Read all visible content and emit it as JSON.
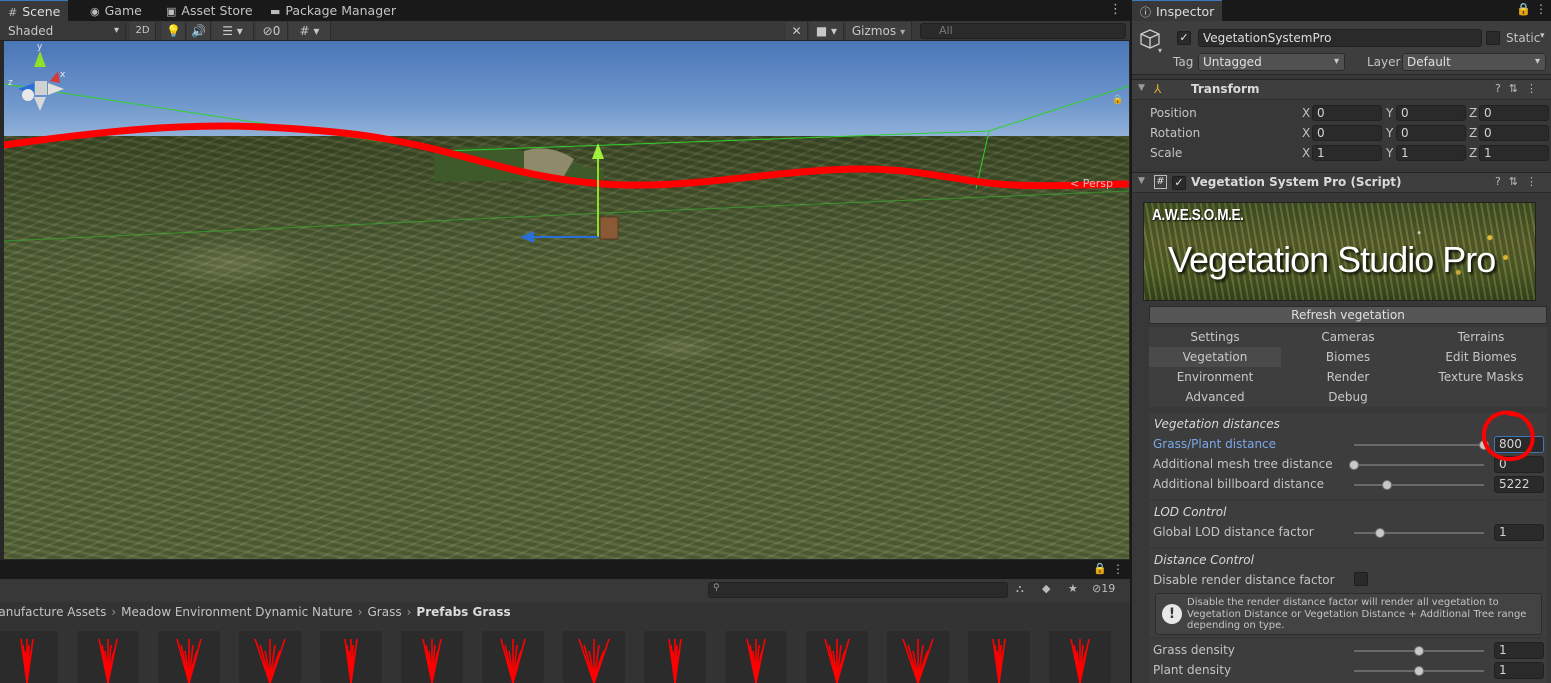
{
  "scene_tabs": {
    "scene": "Scene",
    "game": "Game",
    "asset_store": "Asset Store",
    "package_manager": "Package Manager"
  },
  "scene_toolbar": {
    "shading_mode": "Shaded",
    "mode_2d": "2D",
    "hidden_count": "0",
    "gizmos": "Gizmos",
    "search_placeholder": "All"
  },
  "viewport": {
    "persp_label": "< Persp",
    "gizmo_axes": {
      "x": "x",
      "y": "y",
      "z": "z"
    }
  },
  "project": {
    "hidden_count": "19",
    "breadcrumb": [
      "Manufacture Assets",
      "Meadow Environment Dynamic Nature",
      "Grass",
      "Prefabs Grass"
    ],
    "asset_count": 14
  },
  "inspector": {
    "tab": "Inspector",
    "object_name": "VegetationSystemPro",
    "static_label": "Static",
    "tag_label": "Tag",
    "tag_value": "Untagged",
    "layer_label": "Layer",
    "layer_value": "Default",
    "transform": {
      "title": "Transform",
      "rows": [
        {
          "label": "Position",
          "x": "0",
          "y": "0",
          "z": "0"
        },
        {
          "label": "Rotation",
          "x": "0",
          "y": "0",
          "z": "0"
        },
        {
          "label": "Scale",
          "x": "1",
          "y": "1",
          "z": "1"
        }
      ]
    },
    "script": {
      "title": "Vegetation System Pro (Script)",
      "banner_small": "A.W.E.S.O.M.E.",
      "banner_big": "Vegetation Studio Pro",
      "refresh_button": "Refresh vegetation",
      "menu": [
        [
          "Settings",
          "Cameras",
          "Terrains"
        ],
        [
          "Vegetation",
          "Biomes",
          "Edit Biomes"
        ],
        [
          "Environment",
          "Render",
          "Texture Masks"
        ],
        [
          "Advanced",
          "Debug",
          ""
        ]
      ],
      "selected_menu": "Vegetation"
    },
    "vegetation_distances": {
      "title": "Vegetation distances",
      "rows": [
        {
          "label": "Grass/Plant distance",
          "value": "800",
          "fraction": 1.0
        },
        {
          "label": "Additional mesh tree distance",
          "value": "0",
          "fraction": 0.0
        },
        {
          "label": "Additional billboard distance",
          "value": "5222",
          "fraction": 0.25
        }
      ]
    },
    "lod_control": {
      "title": "LOD Control",
      "rows": [
        {
          "label": "Global LOD distance factor",
          "value": "1",
          "fraction": 0.2
        }
      ]
    },
    "distance_control": {
      "title": "Distance Control",
      "disable_label": "Disable render distance factor",
      "help": "Disable the render distance factor will render all vegetation to Vegetation Distance or Vegetation Distance + Additional Tree range depending on type."
    },
    "density": {
      "rows": [
        {
          "label": "Grass density",
          "value": "1",
          "fraction": 0.5
        },
        {
          "label": "Plant density",
          "value": "1",
          "fraction": 0.5
        }
      ]
    }
  },
  "colors": {
    "annotation_red": "#ff0000",
    "accent_blue": "#3a79bb",
    "highlight_label": "#7ba9e8"
  }
}
